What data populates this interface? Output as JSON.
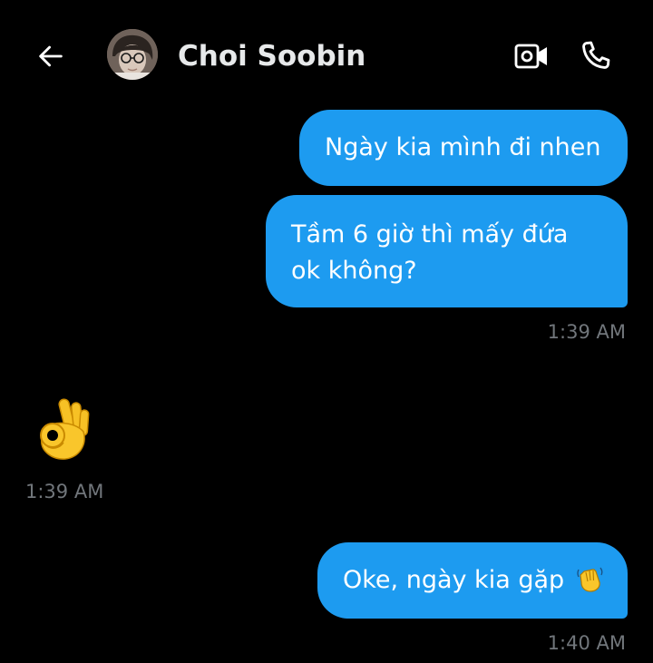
{
  "header": {
    "back_icon": "arrow-left-icon",
    "contact_name": "Choi Soobin",
    "video_icon": "video-camera-icon",
    "call_icon": "phone-icon"
  },
  "messages": [
    {
      "sender": "me",
      "text": "Ngày kia mình đi nhen"
    },
    {
      "sender": "me",
      "text": "Tầm 6 giờ thì mấy đứa ok không?",
      "time": "1:39 AM"
    },
    {
      "sender": "them",
      "emoji": "ok-hand-emoji",
      "time": "1:39 AM"
    },
    {
      "sender": "me",
      "text": "Oke, ngày kia gặp",
      "emoji": "waving-hand-emoji",
      "time": "1:40 AM"
    }
  ],
  "colors": {
    "background": "#000000",
    "bubble": "#1d9bf0",
    "timestamp": "#71767b",
    "name": "#e7e9ea"
  }
}
